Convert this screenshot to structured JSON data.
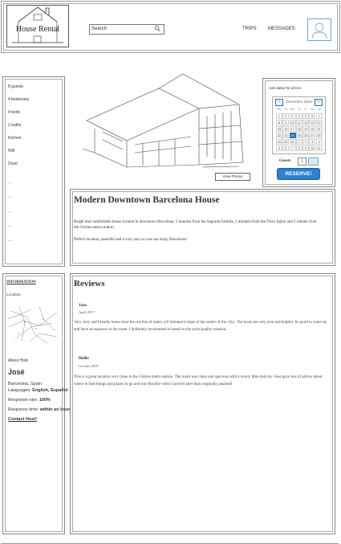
{
  "brand": {
    "logo_text": "House Rental"
  },
  "search": {
    "value": "Search"
  },
  "nav": {
    "trips": "TRIPS",
    "messages": "MESSAGES"
  },
  "amenities": [
    "8 guests",
    "4 bedrooms",
    "4 beds",
    "2 baths",
    "Kitchen",
    "Wifi",
    "Dryer",
    "...",
    "...",
    "...",
    "...",
    "..."
  ],
  "photos": {
    "view_label": "View Photos"
  },
  "booking": {
    "add_dates": "Add dates for prices",
    "prev": "<",
    "next": ">",
    "month": "December 2019",
    "weekdays": [
      "Mo",
      "Tu",
      "We",
      "Th",
      "Fr",
      "Sa",
      "Su"
    ],
    "weeks": [
      [
        "1",
        "2",
        "3",
        "4",
        "5",
        "6",
        "7"
      ],
      [
        "8",
        "9",
        "10",
        "11",
        "12",
        "13",
        "14"
      ],
      [
        "15",
        "16",
        "17",
        "18",
        "19",
        "20",
        "21"
      ],
      [
        "22",
        "23",
        "24",
        "25",
        "26",
        "27",
        "28"
      ],
      [
        "29",
        "30",
        "31",
        "1",
        "2",
        "3",
        "4"
      ],
      [
        "5",
        "6",
        "7",
        "8",
        "9",
        "10",
        "11"
      ]
    ],
    "selected_day": "24",
    "guests_label": "Guests",
    "guests_value": "1",
    "reserve_label": "RESERVE!"
  },
  "property": {
    "title": "Modern Downtown Barcelona House",
    "description": "Bright and comfortable house located in downtown Barcelona, 5 minutes from the Sagrada Familia, 2 minutes from the Torre Agbar and 1 minute from the Glories metro station.",
    "tagline": "Perfect location, peaceful and a cozy stay so you can enjoy Barcelona!"
  },
  "info": {
    "title": "INFORMATION",
    "location_label": "Location",
    "about_host_label": "About Host",
    "host_name": "José",
    "host_location": "Barcelona, Spain",
    "languages_label": "Languages:",
    "languages_value": "English, Español",
    "response_rate_label": "Response rate:",
    "response_rate_value": "100%",
    "response_time_label": "Response time:",
    "response_time_value": "within an hour",
    "contact_label": "Contact Host!"
  },
  "reviews": {
    "title": "Reviews",
    "items": [
      {
        "name": "Joao",
        "date": "April 2017",
        "text": "Very cozy and friendly house near the red line of metro (10 minutes/4 stops of the center of the city). The hosts are very nice and helpful. Its good to wake up and have an espresso in the room. I definitely recommend it based on the price/quality relation."
      },
      {
        "name": "Hollie",
        "date": "October 2019",
        "text": "This is a great location very close to the Glories metro station. The room was clean and spacious with a lovely little balcony. José gave lots of advice about where to find things and places to go and was flexible when I arrived later than originally planned!"
      }
    ]
  }
}
